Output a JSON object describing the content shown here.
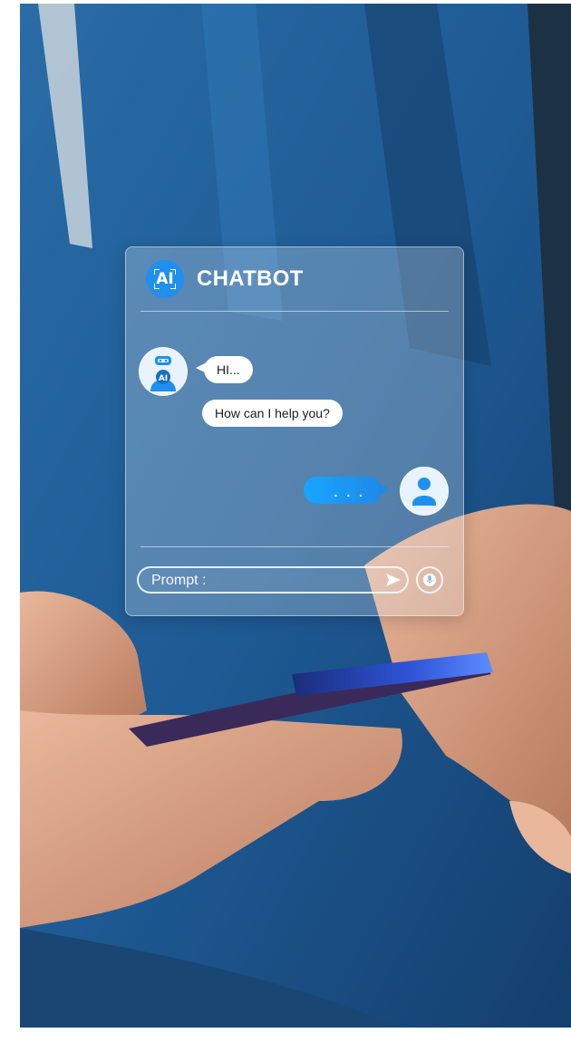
{
  "chatbot": {
    "logo_text": "AI",
    "title": "CHATBOT",
    "messages": [
      {
        "from": "bot",
        "text": "HI..."
      },
      {
        "from": "bot",
        "text": "How can I help you?"
      },
      {
        "from": "user",
        "text": ". . ."
      }
    ],
    "prompt": {
      "placeholder": "Prompt :",
      "value": ""
    },
    "bot_avatar_label": "AI"
  },
  "icons": {
    "logo": "ai-logo-icon",
    "bot": "robot-icon",
    "user": "user-icon",
    "send": "send-icon",
    "mic": "microphone-icon"
  },
  "colors": {
    "accent": "#1f8ff0",
    "user_bubble": "#18a5ff",
    "bot_bubble": "#ffffff",
    "shirt": "#1f5b8f"
  }
}
